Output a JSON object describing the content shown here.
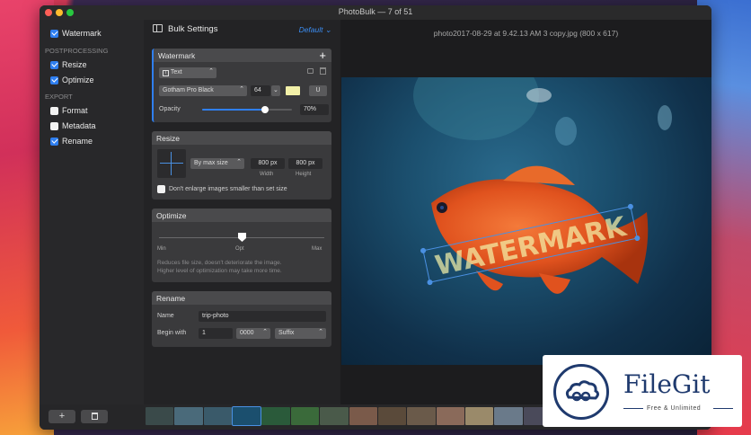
{
  "window": {
    "title": "PhotoBulk — 7 of 51"
  },
  "sidebar": {
    "items": [
      {
        "label": "Watermark",
        "checked": true
      },
      {
        "label": "Resize",
        "checked": true
      },
      {
        "label": "Optimize",
        "checked": true
      },
      {
        "label": "Format",
        "checked": false
      },
      {
        "label": "Metadata",
        "checked": false
      },
      {
        "label": "Rename",
        "checked": true
      }
    ],
    "headers": {
      "postprocessing": "POSTPROCESSING",
      "export": "EXPORT"
    }
  },
  "bottom": {
    "add_label": "+",
    "delete_icon": "trash-icon"
  },
  "settings": {
    "title": "Bulk Settings",
    "preset": "Default",
    "watermark": {
      "title": "Watermark",
      "add_label": "+",
      "type": "Text",
      "font": "Gotham Pro Black",
      "size": "64",
      "color": "#f2f0a8",
      "opacity_label": "Opacity",
      "opacity_value": "70%",
      "opacity_fraction": 0.7
    },
    "resize": {
      "title": "Resize",
      "mode": "By max size",
      "width_value": "800 px",
      "height_value": "800 px",
      "width_label": "Width",
      "height_label": "Height",
      "dont_enlarge": "Don't enlarge images smaller than set size"
    },
    "optimize": {
      "title": "Optimize",
      "min": "Min",
      "opt": "Opt",
      "max": "Max",
      "level": 0.5,
      "description_line1": "Reduces file size, doesn't deteriorate the image.",
      "description_line2": "Higher level of optimization may take more time."
    },
    "rename": {
      "title": "Rename",
      "name_label": "Name",
      "name_value": "trip-photo",
      "begin_label": "Begin with",
      "begin_value": "1",
      "digits": "0000",
      "position": "Suffix"
    }
  },
  "preview": {
    "filename": "photo2017-08-29 at 9.42.13 AM 3 copy.jpg (800 x 617)",
    "watermark_text": "WATERMARK"
  },
  "overlay": {
    "brand": "FileGit",
    "tagline": "Free & Unlimited"
  },
  "colors": {
    "accent": "#2f7ff0",
    "fish": "#e0521e"
  }
}
